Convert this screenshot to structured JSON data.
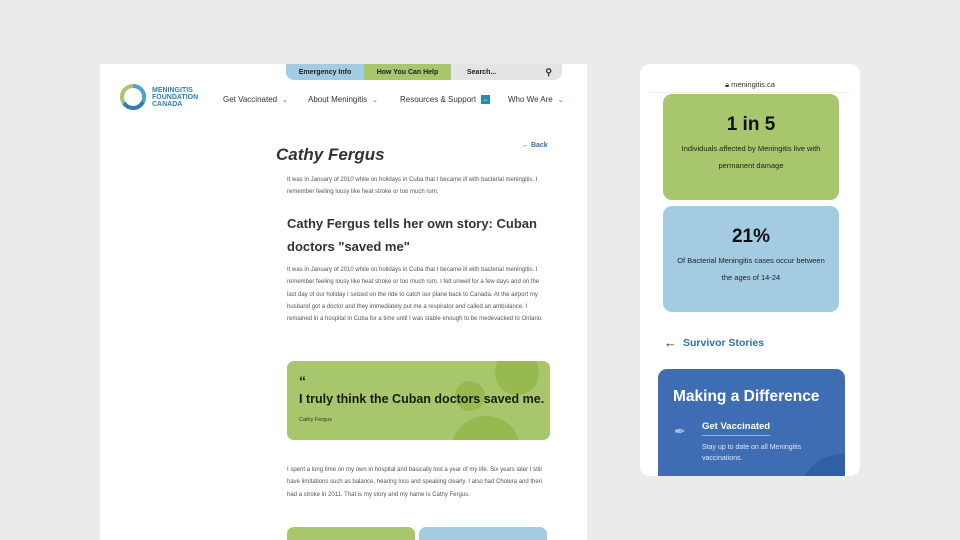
{
  "desktop": {
    "topbar": {
      "emergency": "Emergency Info",
      "help": "How You Can Help",
      "search_placeholder": "Search..."
    },
    "logo": {
      "line1": "MENINGITIS",
      "line2": "FOUNDATION",
      "line3": "CANADA"
    },
    "nav": [
      {
        "label": "Get Vaccinated"
      },
      {
        "label": "About Meningitis"
      },
      {
        "label": "Resources & Support"
      },
      {
        "label": "Who We Are"
      }
    ],
    "title": "Cathy Fergus",
    "back": "Back",
    "intro": "It was in January of 2010 while on holidays in Cuba that I became ill with bacterial meningitis. I remember feeling lousy like heat stroke or too much rum.",
    "heading": "Cathy Fergus tells her own story: Cuban doctors \"saved me\"",
    "story": "It was in January of 2010 while on holidays in Cuba that I became ill with bacterial meningitis. I remember feeling lousy like heat stroke or too much rum. I felt unwell for a few days and on the last day of our holiday I seized on the ride to catch our plane back to Canada. At the airport my husband got a doctor and they immediately put me a respirator and called an ambulance. I remained in a hospital in Cuba for a time until I was stable enough to be medevacked to Ontario.",
    "quote": {
      "mark": "“",
      "text": "I truly think the Cuban doctors saved me.",
      "author": "Cathy Fergus"
    },
    "closing": "I spent a long time on my own in hospital and basically lost a year of my life. Six years later I still have limitations such as balance, hearing loss and speaking clearly. I also had Cholera and then had a stroke in 2011. That is my story and my name is Cathy Fergus."
  },
  "mobile": {
    "url": "meningitis.ca",
    "stats": [
      {
        "value": "1 in 5",
        "desc": "Individuals affected by Meningitis live with permanent damage"
      },
      {
        "value": "21%",
        "desc": "Of Bacterial Meningitis cases occur between the ages of 14-24"
      }
    ],
    "survivor_link": "Survivor Stories",
    "making": {
      "title": "Making a Difference",
      "link": "Get Vaccinated",
      "desc": "Stay up to date on all Meningitis vaccinations."
    }
  },
  "colors": {
    "green": "#a8c66c",
    "light_blue": "#a3cce3",
    "blue": "#3e6db3",
    "link": "#2f6ea8"
  }
}
